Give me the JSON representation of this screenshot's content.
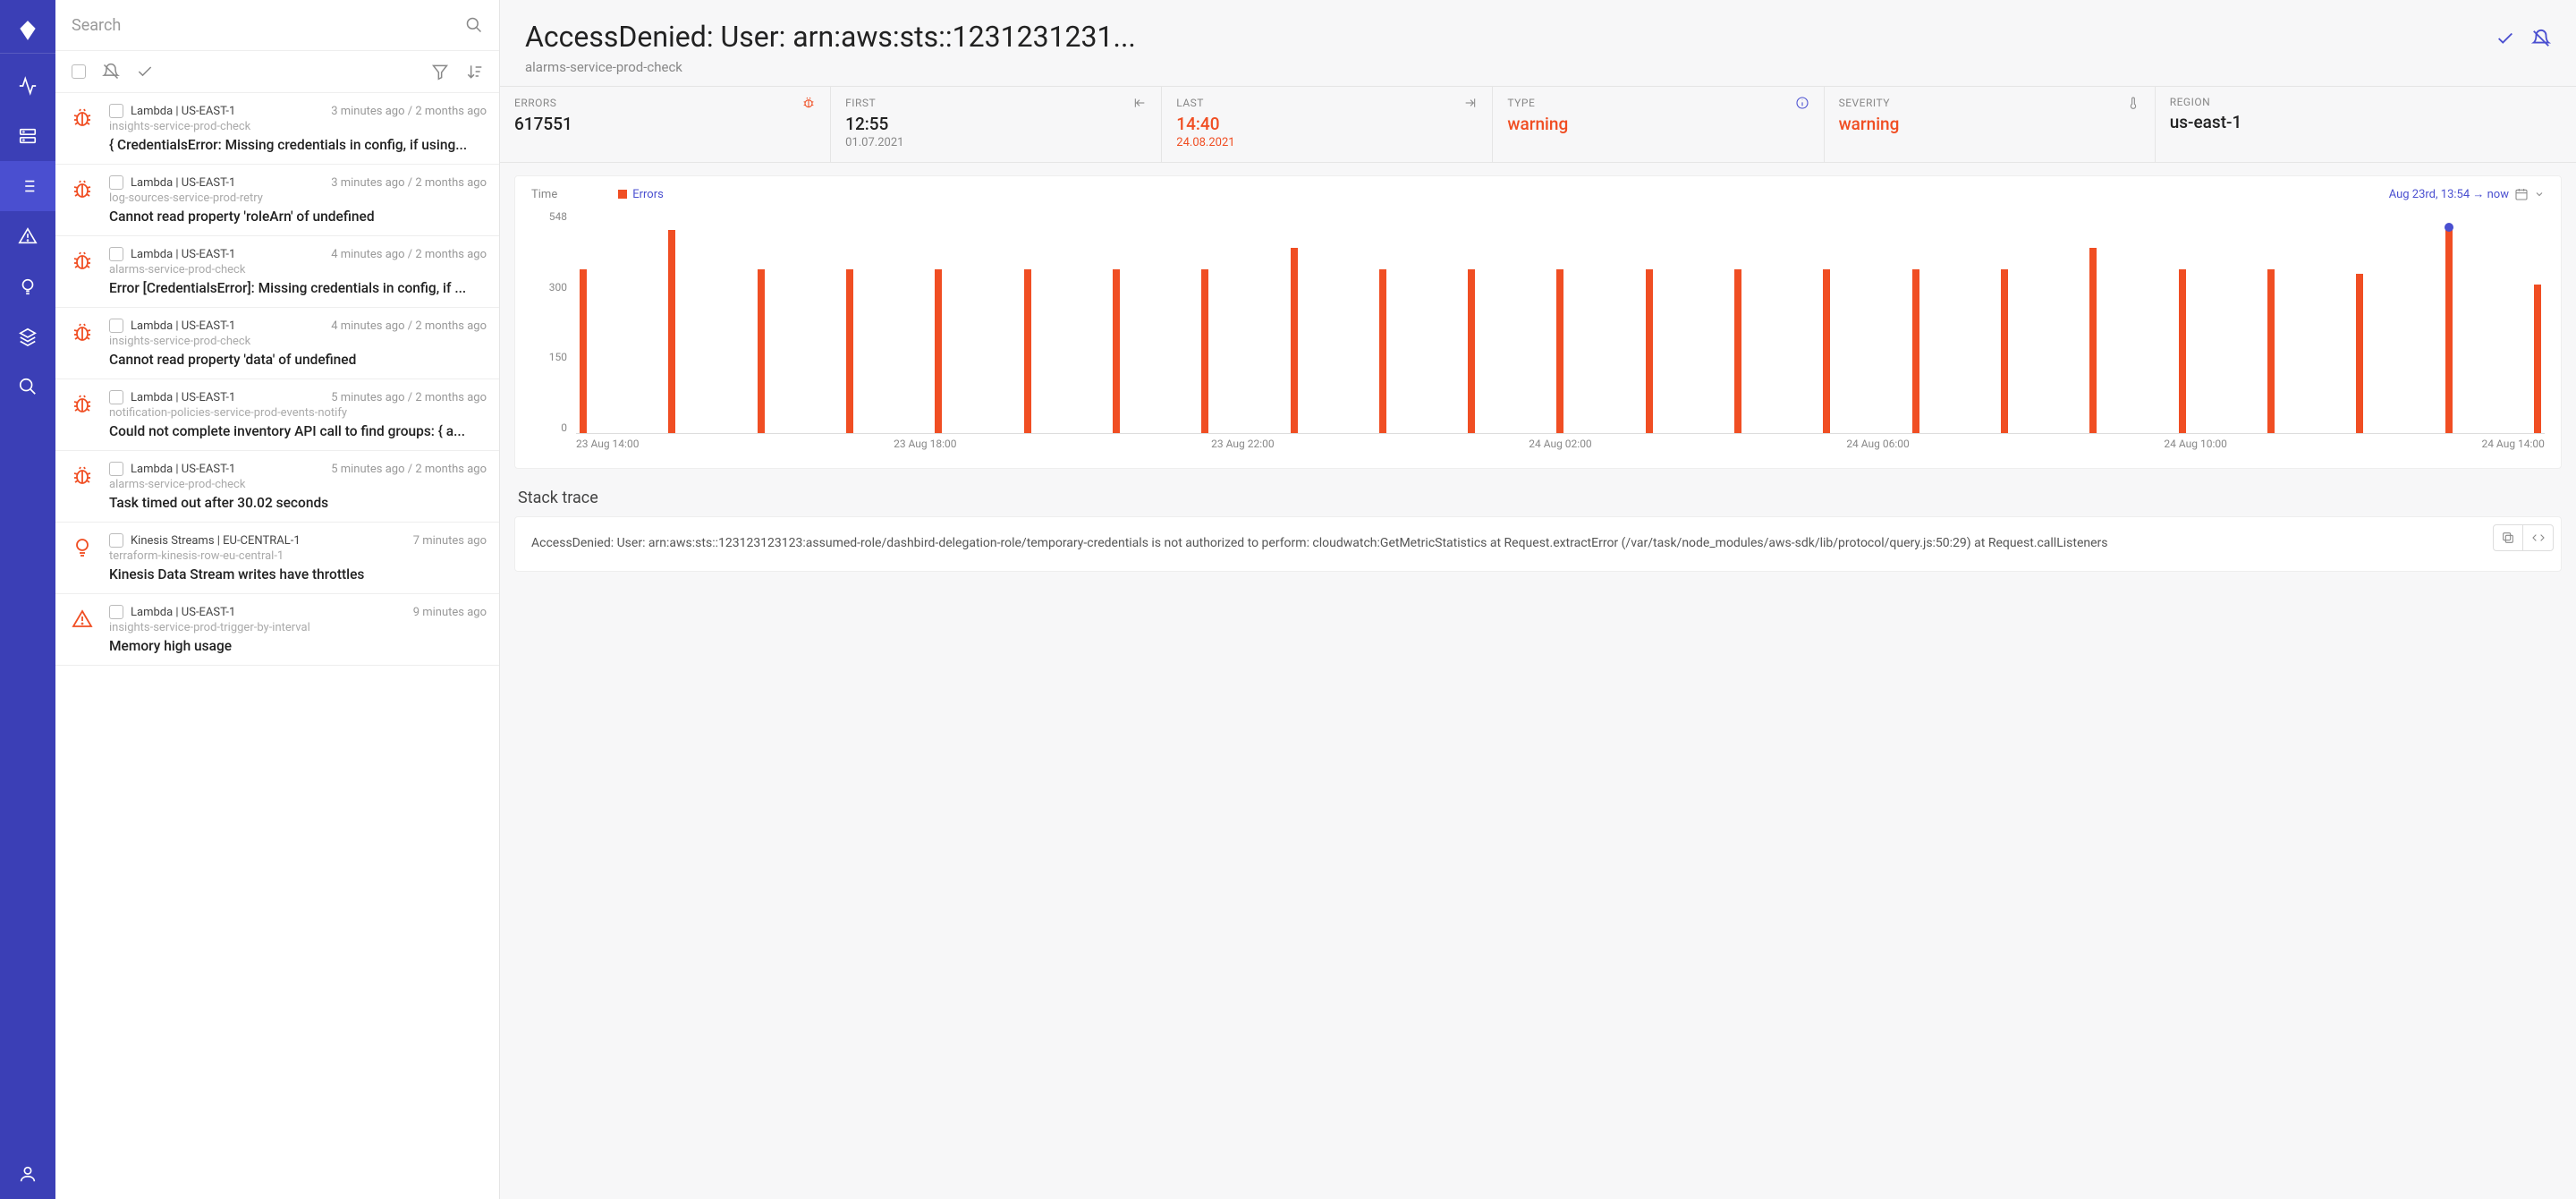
{
  "search": {
    "placeholder": "Search"
  },
  "items": [
    {
      "icon": "bug",
      "service": "Lambda | US-EAST-1",
      "time": "3 minutes ago / 2 months ago",
      "sub": "insights-service-prod-check",
      "title": "{ CredentialsError: Missing credentials in config, if using..."
    },
    {
      "icon": "bug",
      "service": "Lambda | US-EAST-1",
      "time": "3 minutes ago / 2 months ago",
      "sub": "log-sources-service-prod-retry",
      "title": "Cannot read property 'roleArn' of undefined"
    },
    {
      "icon": "bug",
      "service": "Lambda | US-EAST-1",
      "time": "4 minutes ago / 2 months ago",
      "sub": "alarms-service-prod-check",
      "title": "Error [CredentialsError]: Missing credentials in config, if ..."
    },
    {
      "icon": "bug",
      "service": "Lambda | US-EAST-1",
      "time": "4 minutes ago / 2 months ago",
      "sub": "insights-service-prod-check",
      "title": "Cannot read property 'data' of undefined"
    },
    {
      "icon": "bug",
      "service": "Lambda | US-EAST-1",
      "time": "5 minutes ago / 2 months ago",
      "sub": "notification-policies-service-prod-events-notify",
      "title": "Could not complete inventory API call to find groups: { a..."
    },
    {
      "icon": "bug",
      "service": "Lambda | US-EAST-1",
      "time": "5 minutes ago / 2 months ago",
      "sub": "alarms-service-prod-check",
      "title": "Task timed out after 30.02 seconds"
    },
    {
      "icon": "bulb",
      "service": "Kinesis Streams | EU-CENTRAL-1",
      "time": "7 minutes ago",
      "sub": "terraform-kinesis-row-eu-central-1",
      "title": "Kinesis Data Stream writes have throttles"
    },
    {
      "icon": "tri",
      "service": "Lambda | US-EAST-1",
      "time": "9 minutes ago",
      "sub": "insights-service-prod-trigger-by-interval",
      "title": "Memory high usage"
    }
  ],
  "detail": {
    "title": "AccessDenied: User: arn:aws:sts::1231231231...",
    "sub": "alarms-service-prod-check"
  },
  "stats": {
    "errors": {
      "label": "ERRORS",
      "value": "617551"
    },
    "first": {
      "label": "FIRST",
      "value": "12:55",
      "sub": "01.07.2021"
    },
    "last": {
      "label": "LAST",
      "value": "14:40",
      "sub": "24.08.2021"
    },
    "type": {
      "label": "TYPE",
      "value": "warning"
    },
    "severity": {
      "label": "SEVERITY",
      "value": "warning"
    },
    "region": {
      "label": "REGION",
      "value": "us-east-1"
    }
  },
  "chart_legend": {
    "time": "Time",
    "errors": "Errors",
    "range": "Aug 23rd, 13:54 → now"
  },
  "chart_data": {
    "type": "bar",
    "title": "Errors",
    "xlabel": "",
    "ylabel": "",
    "ylim": [
      0,
      600
    ],
    "yticks": [
      0,
      150,
      300,
      548
    ],
    "categories_labels": [
      "23 Aug 14:00",
      "23 Aug 18:00",
      "23 Aug 22:00",
      "24 Aug 02:00",
      "24 Aug 06:00",
      "24 Aug 10:00",
      "24 Aug 14:00"
    ],
    "values": [
      440,
      548,
      440,
      440,
      440,
      440,
      440,
      440,
      500,
      440,
      440,
      440,
      440,
      440,
      440,
      440,
      440,
      500,
      440,
      440,
      430,
      548,
      400
    ]
  },
  "stack": {
    "title": "Stack trace",
    "text": "  AccessDenied: User: arn:aws:sts::123123123123:assumed-role/dashbird-delegation-role/temporary-credentials is not authorized to perform: cloudwatch:GetMetricStatistics        at Request.extractError (/var/task/node_modules/aws-sdk/lib/protocol/query.js:50:29)      at Request.callListeners"
  }
}
